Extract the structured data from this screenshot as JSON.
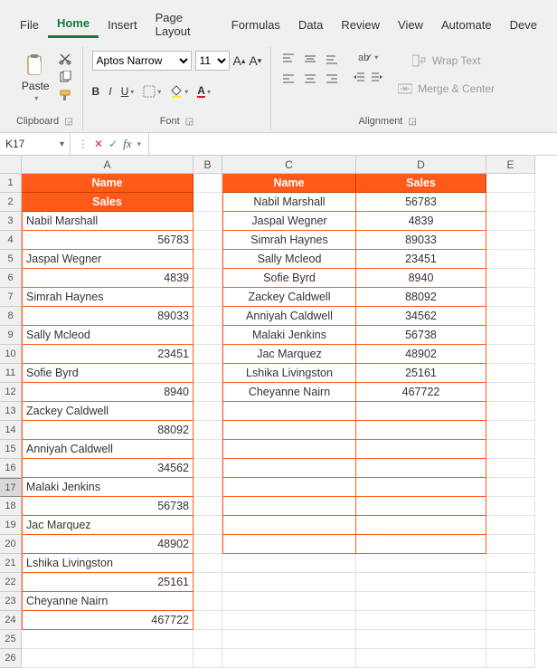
{
  "tabs": [
    "File",
    "Home",
    "Insert",
    "Page Layout",
    "Formulas",
    "Data",
    "Review",
    "View",
    "Automate",
    "Deve"
  ],
  "active_tab": "Home",
  "ribbon": {
    "clipboard": {
      "paste": "Paste",
      "label": "Clipboard"
    },
    "font": {
      "name": "Aptos Narrow",
      "size": "11",
      "bold": "B",
      "italic": "I",
      "underline": "U",
      "label": "Font"
    },
    "alignment": {
      "wrap": "Wrap Text",
      "merge": "Merge & Center",
      "label": "Alignment"
    }
  },
  "formula_bar": {
    "name_box": "K17",
    "fx": "fx",
    "value": ""
  },
  "columns": [
    "A",
    "B",
    "C",
    "D",
    "E"
  ],
  "col_widths": {
    "A": 190,
    "B": 32,
    "C": 148,
    "D": 144,
    "E": 54
  },
  "colA_header1": "Name",
  "colA_header2": "Sales",
  "colCD_headers": {
    "name": "Name",
    "sales": "Sales"
  },
  "left_data": [
    {
      "name": "Nabil Marshall",
      "sales": "56783"
    },
    {
      "name": "Jaspal Wegner",
      "sales": "4839"
    },
    {
      "name": "Simrah Haynes",
      "sales": "89033"
    },
    {
      "name": "Sally Mcleod",
      "sales": "23451"
    },
    {
      "name": "Sofie Byrd",
      "sales": "8940"
    },
    {
      "name": "Zackey Caldwell",
      "sales": "88092"
    },
    {
      "name": "Anniyah Caldwell",
      "sales": "34562"
    },
    {
      "name": "Malaki Jenkins",
      "sales": "56738"
    },
    {
      "name": "Jac Marquez",
      "sales": "48902"
    },
    {
      "name": "Lshika Livingston",
      "sales": "25161"
    },
    {
      "name": "Cheyanne Nairn",
      "sales": "467722"
    }
  ],
  "right_data": [
    {
      "name": "Nabil Marshall",
      "sales": "56783"
    },
    {
      "name": "Jaspal Wegner",
      "sales": "4839"
    },
    {
      "name": "Simrah Haynes",
      "sales": "89033"
    },
    {
      "name": "Sally Mcleod",
      "sales": "23451"
    },
    {
      "name": "Sofie Byrd",
      "sales": "8940"
    },
    {
      "name": "Zackey Caldwell",
      "sales": "88092"
    },
    {
      "name": "Anniyah Caldwell",
      "sales": "34562"
    },
    {
      "name": "Malaki Jenkins",
      "sales": "56738"
    },
    {
      "name": "Jac Marquez",
      "sales": "48902"
    },
    {
      "name": "Lshika Livingston",
      "sales": "25161"
    },
    {
      "name": "Cheyanne Nairn",
      "sales": "467722"
    }
  ],
  "selected_row": 17,
  "row_count": 26
}
